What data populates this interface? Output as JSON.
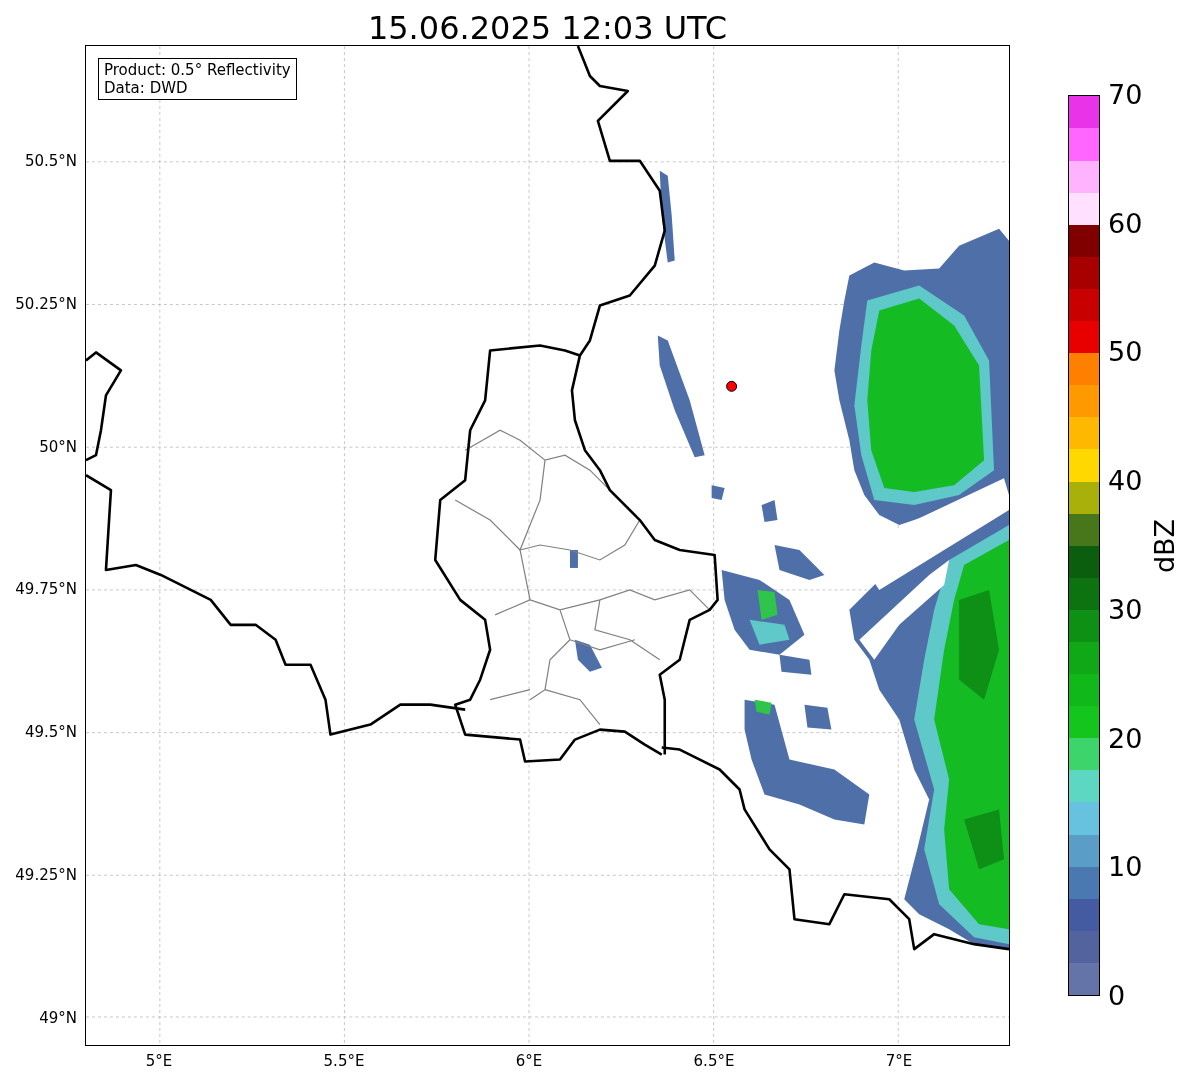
{
  "title": "15.06.2025 12:03 UTC",
  "map": {
    "info": [
      "Product: 0.5° Reflectivity",
      "Data: DWD"
    ],
    "lat_labels": [
      "50.5°N",
      "50.25°N",
      "50°N",
      "49.75°N",
      "49.5°N",
      "49.25°N",
      "49°N"
    ],
    "lon_labels": [
      "5°E",
      "5.5°E",
      "6°E",
      "6.5°E",
      "7°E"
    ]
  },
  "colorbar": {
    "label": "dBZ",
    "ticks": [
      "70",
      "60",
      "50",
      "40",
      "30",
      "20",
      "10",
      "0"
    ],
    "segments": [
      {
        "color": "#6473a8"
      },
      {
        "color": "#52639d"
      },
      {
        "color": "#445ba1"
      },
      {
        "color": "#4a78b0"
      },
      {
        "color": "#5a9ec8"
      },
      {
        "color": "#66c2de"
      },
      {
        "color": "#5dd6c2"
      },
      {
        "color": "#3ed46c"
      },
      {
        "color": "#13c51d"
      },
      {
        "color": "#11b81a"
      },
      {
        "color": "#10a817"
      },
      {
        "color": "#0e9014"
      },
      {
        "color": "#0c7310"
      },
      {
        "color": "#0a5e0d"
      },
      {
        "color": "#48761a"
      },
      {
        "color": "#aab00a"
      },
      {
        "color": "#ffd800"
      },
      {
        "color": "#ffb800"
      },
      {
        "color": "#ff9900"
      },
      {
        "color": "#ff7f00"
      },
      {
        "color": "#e80000"
      },
      {
        "color": "#c80000"
      },
      {
        "color": "#a80000"
      },
      {
        "color": "#800000"
      },
      {
        "color": "#ffe0ff"
      },
      {
        "color": "#ffb3ff"
      },
      {
        "color": "#ff66ff"
      },
      {
        "color": "#e833e8"
      }
    ]
  }
}
